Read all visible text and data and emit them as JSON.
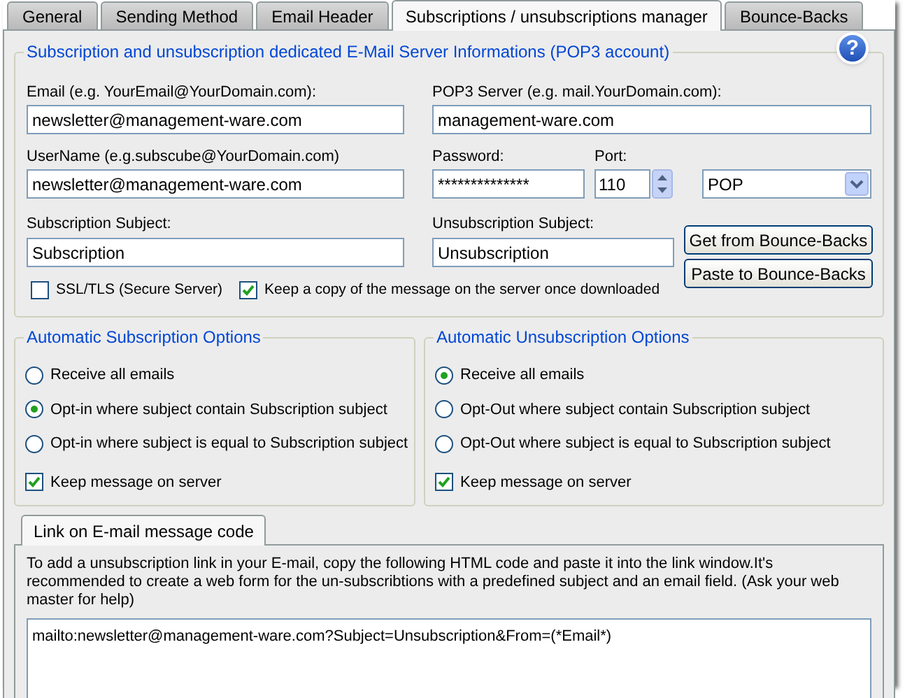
{
  "tabs": [
    {
      "label": "General",
      "selected": false
    },
    {
      "label": "Sending Method",
      "selected": false
    },
    {
      "label": "Email Header",
      "selected": false
    },
    {
      "label": "Subscriptions / unsubscriptions manager",
      "selected": true
    },
    {
      "label": "Bounce-Backs",
      "selected": false
    }
  ],
  "server_group": {
    "title": "Subscription and unsubscription dedicated E-Mail Server Informations (POP3 account)",
    "help_button": "?",
    "email": {
      "label": "Email (e.g. YourEmail@YourDomain.com):",
      "value": "newsletter@management-ware.com"
    },
    "pop3_server": {
      "label": "POP3 Server (e.g. mail.YourDomain.com):",
      "value": "management-ware.com"
    },
    "username": {
      "label": "UserName (e.g.subscube@YourDomain.com)",
      "value": "newsletter@management-ware.com"
    },
    "password": {
      "label": "Password:",
      "value": "**************"
    },
    "port": {
      "label": "Port:",
      "value": "110"
    },
    "protocol": {
      "value": "POP"
    },
    "subscription_subject": {
      "label": "Subscription Subject:",
      "value": "Subscription"
    },
    "unsubscription_subject": {
      "label": "Unsubscription Subject:",
      "value": "Unsubscription"
    },
    "checkboxes": [
      {
        "label": "SSL/TLS (Secure Server)",
        "checked": false
      },
      {
        "label": "Keep a copy of the message on the server once downloaded",
        "checked": true
      }
    ],
    "buttons": [
      "Get from Bounce-Backs",
      "Paste to Bounce-Backs"
    ]
  },
  "subscription_options": {
    "title": "Automatic Subscription Options",
    "options": [
      {
        "label": "Receive all emails",
        "selected": false
      },
      {
        "label": "Opt-in where subject contain Subscription subject",
        "selected": true
      },
      {
        "label": "Opt-in where subject is equal to Subscription subject",
        "selected": false
      }
    ],
    "keep_on_server": {
      "label": "Keep message on server",
      "checked": true
    }
  },
  "unsubscription_options": {
    "title": "Automatic Unsubscription Options",
    "options": [
      {
        "label": "Receive all emails",
        "selected": true
      },
      {
        "label": "Opt-Out where subject contain Subscription subject",
        "selected": false
      },
      {
        "label": "Opt-Out where subject is equal to Subscription subject",
        "selected": false
      }
    ],
    "keep_on_server": {
      "label": "Keep message on server",
      "checked": true
    }
  },
  "link_section": {
    "tab": {
      "label": "Link on E-mail message code",
      "selected": true
    },
    "description": "To add a unsubscription link in your E-mail, copy the following HTML code and paste it into the link window.It's recommended to create a web form for the un-subscribtions with a predefined subject and an email field. (Ask your web master for help)",
    "code": "mailto:newsletter@management-ware.com?Subject=Unsubscription&From=(*Email*)"
  }
}
